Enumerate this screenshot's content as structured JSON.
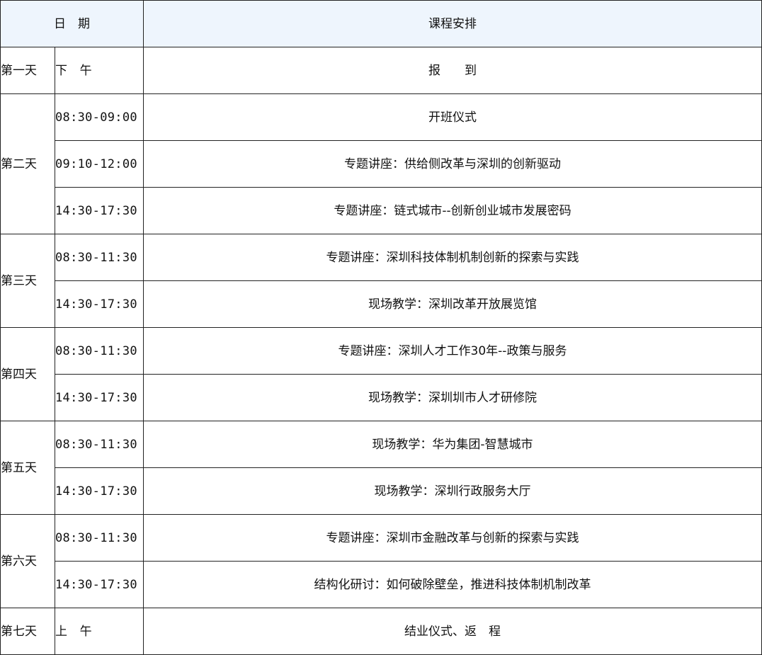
{
  "header": {
    "date": "日　期",
    "course": "课程安排"
  },
  "days": [
    {
      "day": "第一天",
      "sessions": [
        {
          "time": "下　午",
          "course": "报　　到"
        }
      ]
    },
    {
      "day": "第二天",
      "sessions": [
        {
          "time": "08:30-09:00",
          "course": "开班仪式"
        },
        {
          "time": "09:10-12:00",
          "course": "专题讲座：供给侧改革与深圳的创新驱动"
        },
        {
          "time": "14:30-17:30",
          "course": "专题讲座：链式城市--创新创业城市发展密码"
        }
      ]
    },
    {
      "day": "第三天",
      "sessions": [
        {
          "time": "08:30-11:30",
          "course": "专题讲座：深圳科技体制机制创新的探索与实践"
        },
        {
          "time": "14:30-17:30",
          "course": "现场教学：深圳改革开放展览馆"
        }
      ]
    },
    {
      "day": "第四天",
      "sessions": [
        {
          "time": "08:30-11:30",
          "course": "专题讲座：深圳人才工作30年--政策与服务"
        },
        {
          "time": "14:30-17:30",
          "course": "现场教学：深圳圳市人才研修院"
        }
      ]
    },
    {
      "day": "第五天",
      "sessions": [
        {
          "time": "08:30-11:30",
          "course": "现场教学：华为集团-智慧城市"
        },
        {
          "time": "14:30-17:30",
          "course": "现场教学：深圳行政服务大厅"
        }
      ]
    },
    {
      "day": "第六天",
      "sessions": [
        {
          "time": "08:30-11:30",
          "course": "专题讲座：深圳市金融改革与创新的探索与实践"
        },
        {
          "time": "14:30-17:30",
          "course": "结构化研讨：如何破除壁垒，推进科技体制机制改革"
        }
      ]
    },
    {
      "day": "第七天",
      "sessions": [
        {
          "time": "上　午",
          "course": "结业仪式、返　程"
        }
      ]
    }
  ]
}
